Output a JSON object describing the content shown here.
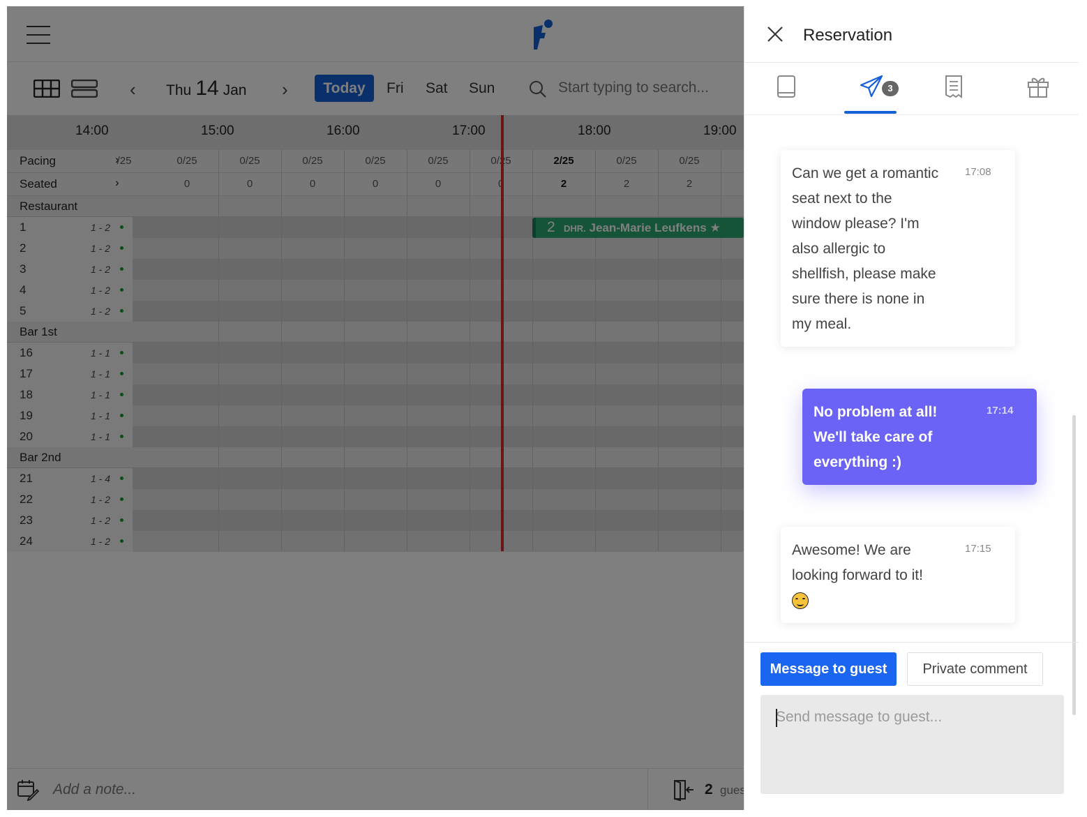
{
  "toolbar": {
    "day_name": "Thu",
    "day_num": "14",
    "month": "Jan",
    "today_label": "Today",
    "next_days": [
      "Fri",
      "Sat",
      "Sun"
    ],
    "search_placeholder": "Start typing to search..."
  },
  "timeline": {
    "times": [
      "14:00",
      "15:00",
      "16:00",
      "17:00",
      "18:00",
      "19:00"
    ]
  },
  "stats": {
    "pacing_label": "Pacing",
    "seated_label": "Seated",
    "pacing_values": [
      "/25",
      "0/25",
      "0/25",
      "0/25",
      "0/25",
      "0/25",
      "0/25",
      "2/25",
      "0/25",
      "0/25"
    ],
    "seated_values": [
      "",
      "0",
      "0",
      "0",
      "0",
      "0",
      "0",
      "2",
      "2",
      "2"
    ]
  },
  "sections": [
    {
      "name": "Restaurant",
      "tables": [
        {
          "num": "1",
          "cap": "1 - 2"
        },
        {
          "num": "2",
          "cap": "1 - 2"
        },
        {
          "num": "3",
          "cap": "1 - 2"
        },
        {
          "num": "4",
          "cap": "1 - 2"
        },
        {
          "num": "5",
          "cap": "1 - 2"
        }
      ]
    },
    {
      "name": "Bar 1st",
      "tables": [
        {
          "num": "16",
          "cap": "1 - 1"
        },
        {
          "num": "17",
          "cap": "1 - 1"
        },
        {
          "num": "18",
          "cap": "1 - 1"
        },
        {
          "num": "19",
          "cap": "1 - 1"
        },
        {
          "num": "20",
          "cap": "1 - 1"
        }
      ]
    },
    {
      "name": "Bar 2nd",
      "tables": [
        {
          "num": "21",
          "cap": "1 - 4"
        },
        {
          "num": "22",
          "cap": "1 - 2"
        },
        {
          "num": "23",
          "cap": "1 - 2"
        },
        {
          "num": "24",
          "cap": "1 - 2"
        }
      ]
    }
  ],
  "reservation_block": {
    "guests": "2",
    "prefix": "DHR.",
    "name": "Jean-Marie Leufkens",
    "star": "★"
  },
  "bottom_bar": {
    "note_placeholder": "Add a note...",
    "guest_count": "2",
    "guest_label": "gues"
  },
  "panel": {
    "title": "Reservation",
    "message_badge": "3",
    "messages": [
      {
        "dir": "in",
        "time": "17:08",
        "lines": [
          "Can we get a romantic",
          "seat next to the",
          "window please? I'm",
          "also allergic to",
          "shellfish, please make",
          "sure there is none in",
          "my meal."
        ]
      },
      {
        "dir": "out",
        "time": "17:14",
        "lines": [
          "No problem at all!",
          "We'll take care of",
          "everything :)"
        ]
      },
      {
        "dir": "in",
        "time": "17:15",
        "lines": [
          "Awesome! We are",
          "looking forward to it!"
        ]
      }
    ],
    "message_to_guest_label": "Message to guest",
    "private_comment_label": "Private comment",
    "input_placeholder": "Send message to guest..."
  },
  "colors": {
    "primary": "#1560d8",
    "outgoing_bubble": "#6a63f5",
    "reservation_green": "#2aa872",
    "now_line": "#d42c2c"
  }
}
